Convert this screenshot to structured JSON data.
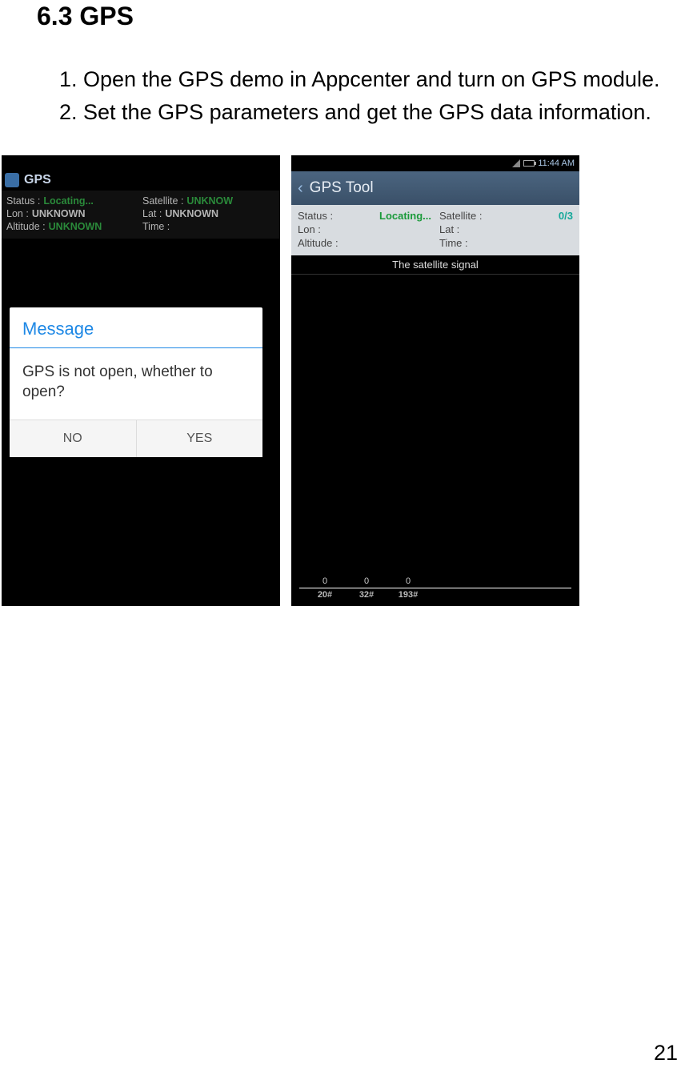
{
  "doc": {
    "heading": "6.3 GPS",
    "instruction1": "1. Open the GPS demo in Appcenter and turn on GPS module.",
    "instruction2": "2. Set the GPS parameters and get the GPS data information.",
    "page_number": "21"
  },
  "phone1": {
    "title": "GPS",
    "info": {
      "status_label": "Status :",
      "status_value": "Locating...",
      "satellite_label": "Satellite :",
      "satellite_value": "UNKNOW",
      "lon_label": "Lon :",
      "lon_value": "UNKNOWN",
      "lat_label": "Lat :",
      "lat_value": "UNKNOWN",
      "altitude_label": "Altitude :",
      "altitude_value": "UNKNOWN",
      "time_label": "Time :",
      "time_value": ""
    },
    "dialog": {
      "title": "Message",
      "body": "GPS is not open, whether to open?",
      "no": "NO",
      "yes": "YES"
    }
  },
  "phone2": {
    "statusbar_time": "11:44 AM",
    "title": "GPS Tool",
    "info": {
      "status_label": "Status :",
      "status_value": "Locating...",
      "satellite_label": "Satellite :",
      "satellite_value": "0/3",
      "lon_label": "Lon :",
      "lon_value": "",
      "lat_label": "Lat :",
      "lat_value": "",
      "altitude_label": "Altitude :",
      "altitude_value": "",
      "time_label": "Time :",
      "time_value": ""
    },
    "sat_title": "The satellite signal"
  },
  "chart_data": {
    "type": "bar",
    "title": "The satellite signal",
    "categories": [
      "20#",
      "32#",
      "193#"
    ],
    "values": [
      0,
      0,
      0
    ],
    "xlabel": "",
    "ylabel": "",
    "ylim": [
      0,
      50
    ]
  }
}
